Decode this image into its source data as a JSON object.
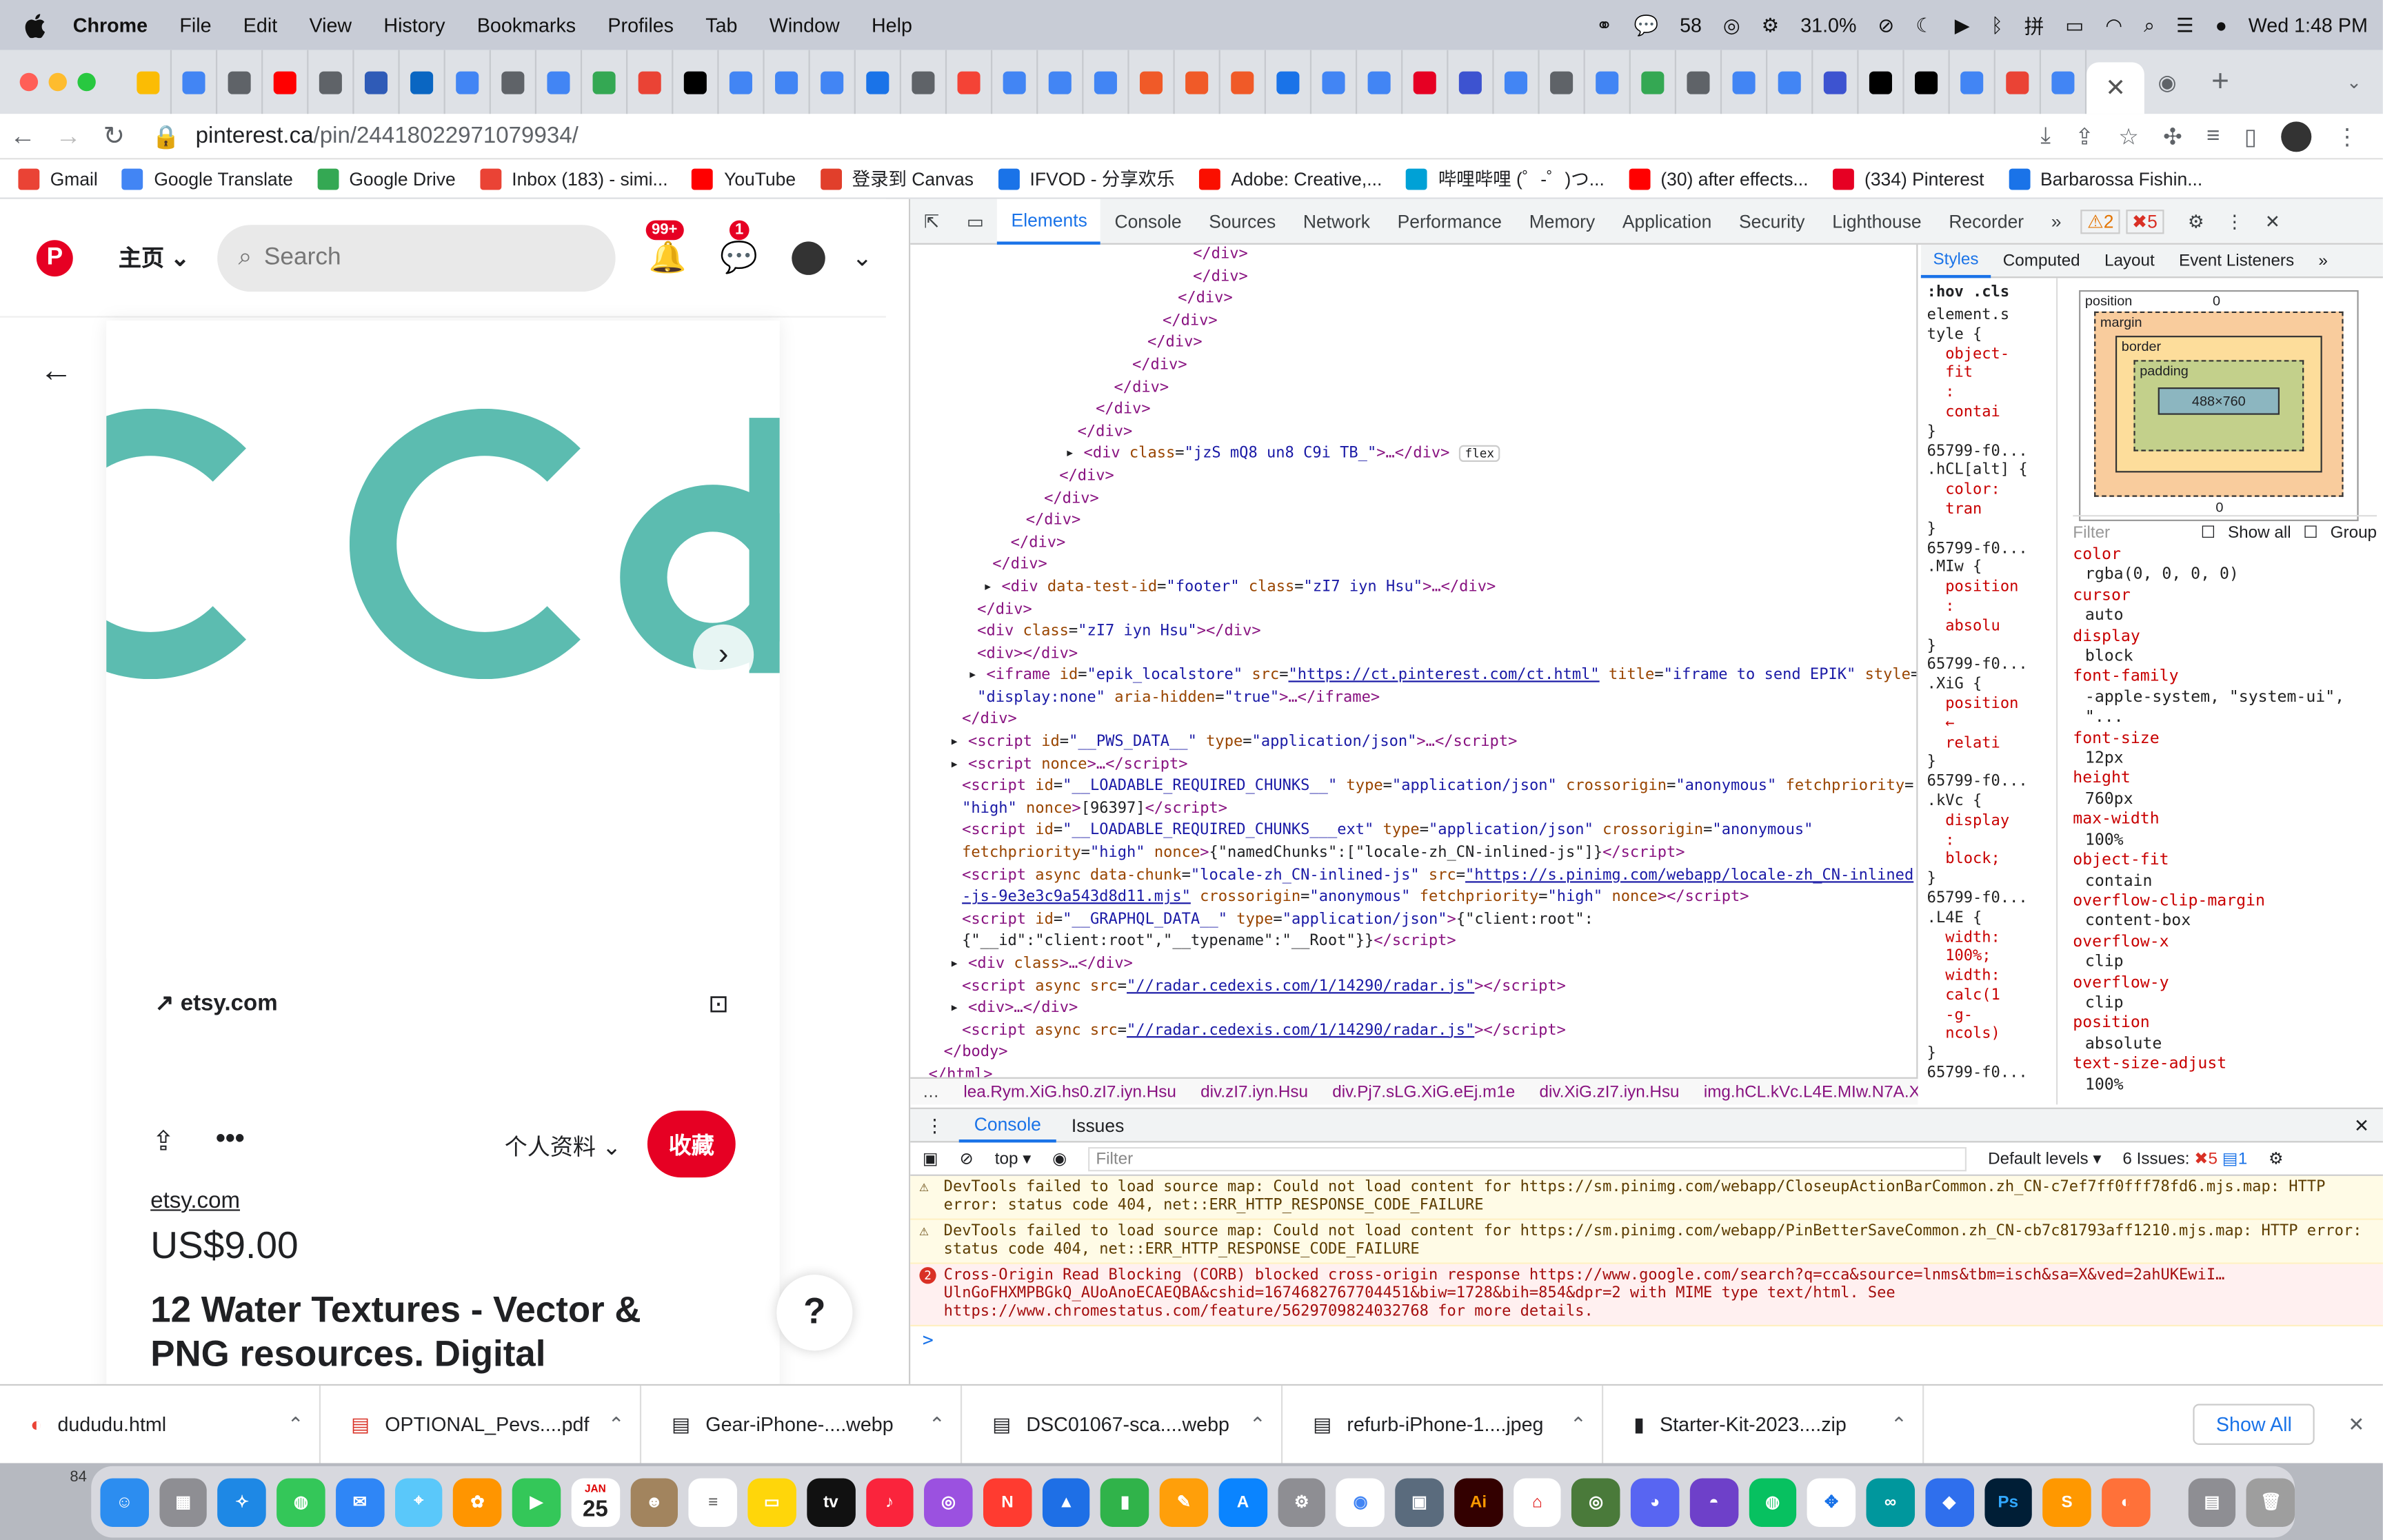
{
  "menubar": {
    "app": "Chrome",
    "items": [
      "File",
      "Edit",
      "View",
      "History",
      "Bookmarks",
      "Profiles",
      "Tab",
      "Window",
      "Help"
    ],
    "wechat_count": "58",
    "cpu": "31.0%",
    "datetime": "Wed  1:48 PM"
  },
  "tabs": {
    "favicons": [
      "#fbbc04",
      "#4285f4",
      "#5f6368",
      "#ff0000",
      "#5f6368",
      "#2f5bb7",
      "#0a66c2",
      "#4285f4",
      "#5f6368",
      "#4285f4",
      "#34a853",
      "#ea4335",
      "#000000",
      "#4285f4",
      "#4285f4",
      "#4285f4",
      "#1a73e8",
      "#5f6368",
      "#f44336",
      "#4285f4",
      "#4285f4",
      "#4285f4",
      "#f05a28",
      "#f05a28",
      "#f05a28",
      "#1a73e8",
      "#4285f4",
      "#4285f4",
      "#e60023",
      "#3d53d0",
      "#4285f4",
      "#5f6368",
      "#4285f4",
      "#34a853",
      "#5f6368",
      "#4285f4",
      "#4285f4",
      "#3d53d0",
      "#000000",
      "#000000",
      "#4285f4",
      "#ea4335",
      "#4285f4"
    ],
    "active_close": "✕",
    "new_tab": "+"
  },
  "toolbar": {
    "url_host": "pinterest.ca",
    "url_path": "/pin/24418022971079934/"
  },
  "bookmarks": [
    {
      "label": "Gmail",
      "color": "#ea4335"
    },
    {
      "label": "Google Translate",
      "color": "#4285f4"
    },
    {
      "label": "Google Drive",
      "color": "#34a853"
    },
    {
      "label": "Inbox (183) - simi...",
      "color": "#ea4335"
    },
    {
      "label": "YouTube",
      "color": "#ff0000"
    },
    {
      "label": "登录到 Canvas",
      "color": "#e13f2b"
    },
    {
      "label": "IFVOD - 分享欢乐",
      "color": "#1a73e8"
    },
    {
      "label": "Adobe: Creative,...",
      "color": "#fa0f00"
    },
    {
      "label": "哔哩哔哩 (゜-゜)つ...",
      "color": "#00a1d6"
    },
    {
      "label": "(30) after effects...",
      "color": "#ff0000"
    },
    {
      "label": "(334) Pinterest",
      "color": "#e60023"
    },
    {
      "label": "Barbarossa Fishin...",
      "color": "#1a73e8"
    }
  ],
  "pinterest": {
    "home": "主页",
    "search_placeholder": "Search",
    "notif_count": "99+",
    "msg_count": "1",
    "source": "etsy.com",
    "profile": "个人资料",
    "save": "收藏",
    "source_link": "etsy.com",
    "price": "US$9.00",
    "title": "12 Water Textures - Vector & PNG resources. Digital",
    "help": "?"
  },
  "devtools": {
    "tabs": [
      "Elements",
      "Console",
      "Sources",
      "Network",
      "Performance",
      "Memory",
      "Application",
      "Security",
      "Lighthouse",
      "Recorder"
    ],
    "warn_count": "2",
    "err_count": "5",
    "crumbs": [
      "lea.Rym.XiG.hs0.zI7.iyn.Hsu",
      "div.zI7.iyn.Hsu",
      "div.Pj7.sLG.XiG.eEj.m1e",
      "div.XiG.zI7.iyn.Hsu",
      "img.hCL.kVc.L4E.MIw.N7A.XiG"
    ],
    "style_tabs": [
      "Styles",
      "Computed",
      "Layout",
      "Event Listeners"
    ],
    "hov": ":hov  .cls",
    "rules": [
      "element.s",
      "tyle {",
      "  object-",
      "  fit",
      "  :",
      "  contai",
      "}",
      "65799-f0...",
      ".hCL[alt] {",
      "  color:",
      "  tran",
      "}",
      "65799-f0...",
      ".MIw {",
      "  position",
      "  :",
      "  absolu",
      "}",
      "65799-f0...",
      ".XiG {",
      "  position",
      "  ←",
      "  relati",
      "}",
      "65799-f0...",
      ".kVc {",
      "  display",
      "  :",
      "  block;",
      "}",
      "65799-f0...",
      ".L4E {",
      "  width:",
      "  100%;",
      "  width:",
      "  calc(1",
      "  -g-",
      "  ncols)",
      "}",
      "65799-f0..."
    ],
    "box": {
      "position": "position",
      "position_val": "0",
      "margin": "margin",
      "border": "border",
      "padding": "padding",
      "dash": "-",
      "content": "488×760"
    },
    "filter": "Filter",
    "show_all": "Show all",
    "group": "Group",
    "computed": [
      {
        "p": "color",
        "v": "rgba(0, 0, 0, 0)"
      },
      {
        "p": "cursor",
        "v": "auto"
      },
      {
        "p": "display",
        "v": "block"
      },
      {
        "p": "font-family",
        "v": "-apple-system, \"system-ui\", \"..."
      },
      {
        "p": "font-size",
        "v": "12px"
      },
      {
        "p": "height",
        "v": "760px"
      },
      {
        "p": "max-width",
        "v": "100%"
      },
      {
        "p": "object-fit",
        "v": "contain"
      },
      {
        "p": "overflow-clip-margin",
        "v": "content-box"
      },
      {
        "p": "overflow-x",
        "v": "clip"
      },
      {
        "p": "overflow-y",
        "v": "clip"
      },
      {
        "p": "position",
        "v": "absolute"
      },
      {
        "p": "text-size-adjust",
        "v": "100%"
      }
    ],
    "console_tabs": [
      "Console",
      "Issues"
    ],
    "context": "top",
    "console_filter": "Filter",
    "levels": "Default levels",
    "issues": "6 Issues:",
    "issues_err": "5",
    "issues_info": "1",
    "messages": [
      {
        "type": "warn",
        "text": "DevTools failed to load source map: Could not load content for https://sm.pinimg.com/webapp/CloseupActionBarCommon.zh_CN-c7ef7ff0fff78fd6.mjs.map: HTTP error: status code 404, net::ERR_HTTP_RESPONSE_CODE_FAILURE"
      },
      {
        "type": "warn",
        "text": "DevTools failed to load source map: Could not load content for https://sm.pinimg.com/webapp/PinBetterSaveCommon.zh_CN-cb7c81793aff1210.mjs.map: HTTP error: status code 404, net::ERR_HTTP_RESPONSE_CODE_FAILURE"
      },
      {
        "type": "err",
        "count": "2",
        "text": "Cross-Origin Read Blocking (CORB) blocked cross-origin response https://www.google.com/search?q=cca&source=lnms&tbm=isch&sa=X&ved=2ahUKEwiI…UlnGoFHXMPBGkQ_AUoAnoECAEQBA&cshid=1674682767704451&biw=1728&bih=854&dpr=2 with MIME type text/html. See https://www.chromestatus.com/feature/5629709824032768 for more details."
      }
    ],
    "prompt": ">"
  },
  "downloads": {
    "items": [
      "dududu.html",
      "OPTIONAL_Pevs....pdf",
      "Gear-iPhone-....webp",
      "DSC01067-sca....webp",
      "refurb-iPhone-1....jpeg",
      "Starter-Kit-2023....zip"
    ],
    "show_all": "Show All"
  },
  "dock": {
    "calendar_month": "JAN",
    "calendar_day": "25",
    "finder_count": "84"
  }
}
